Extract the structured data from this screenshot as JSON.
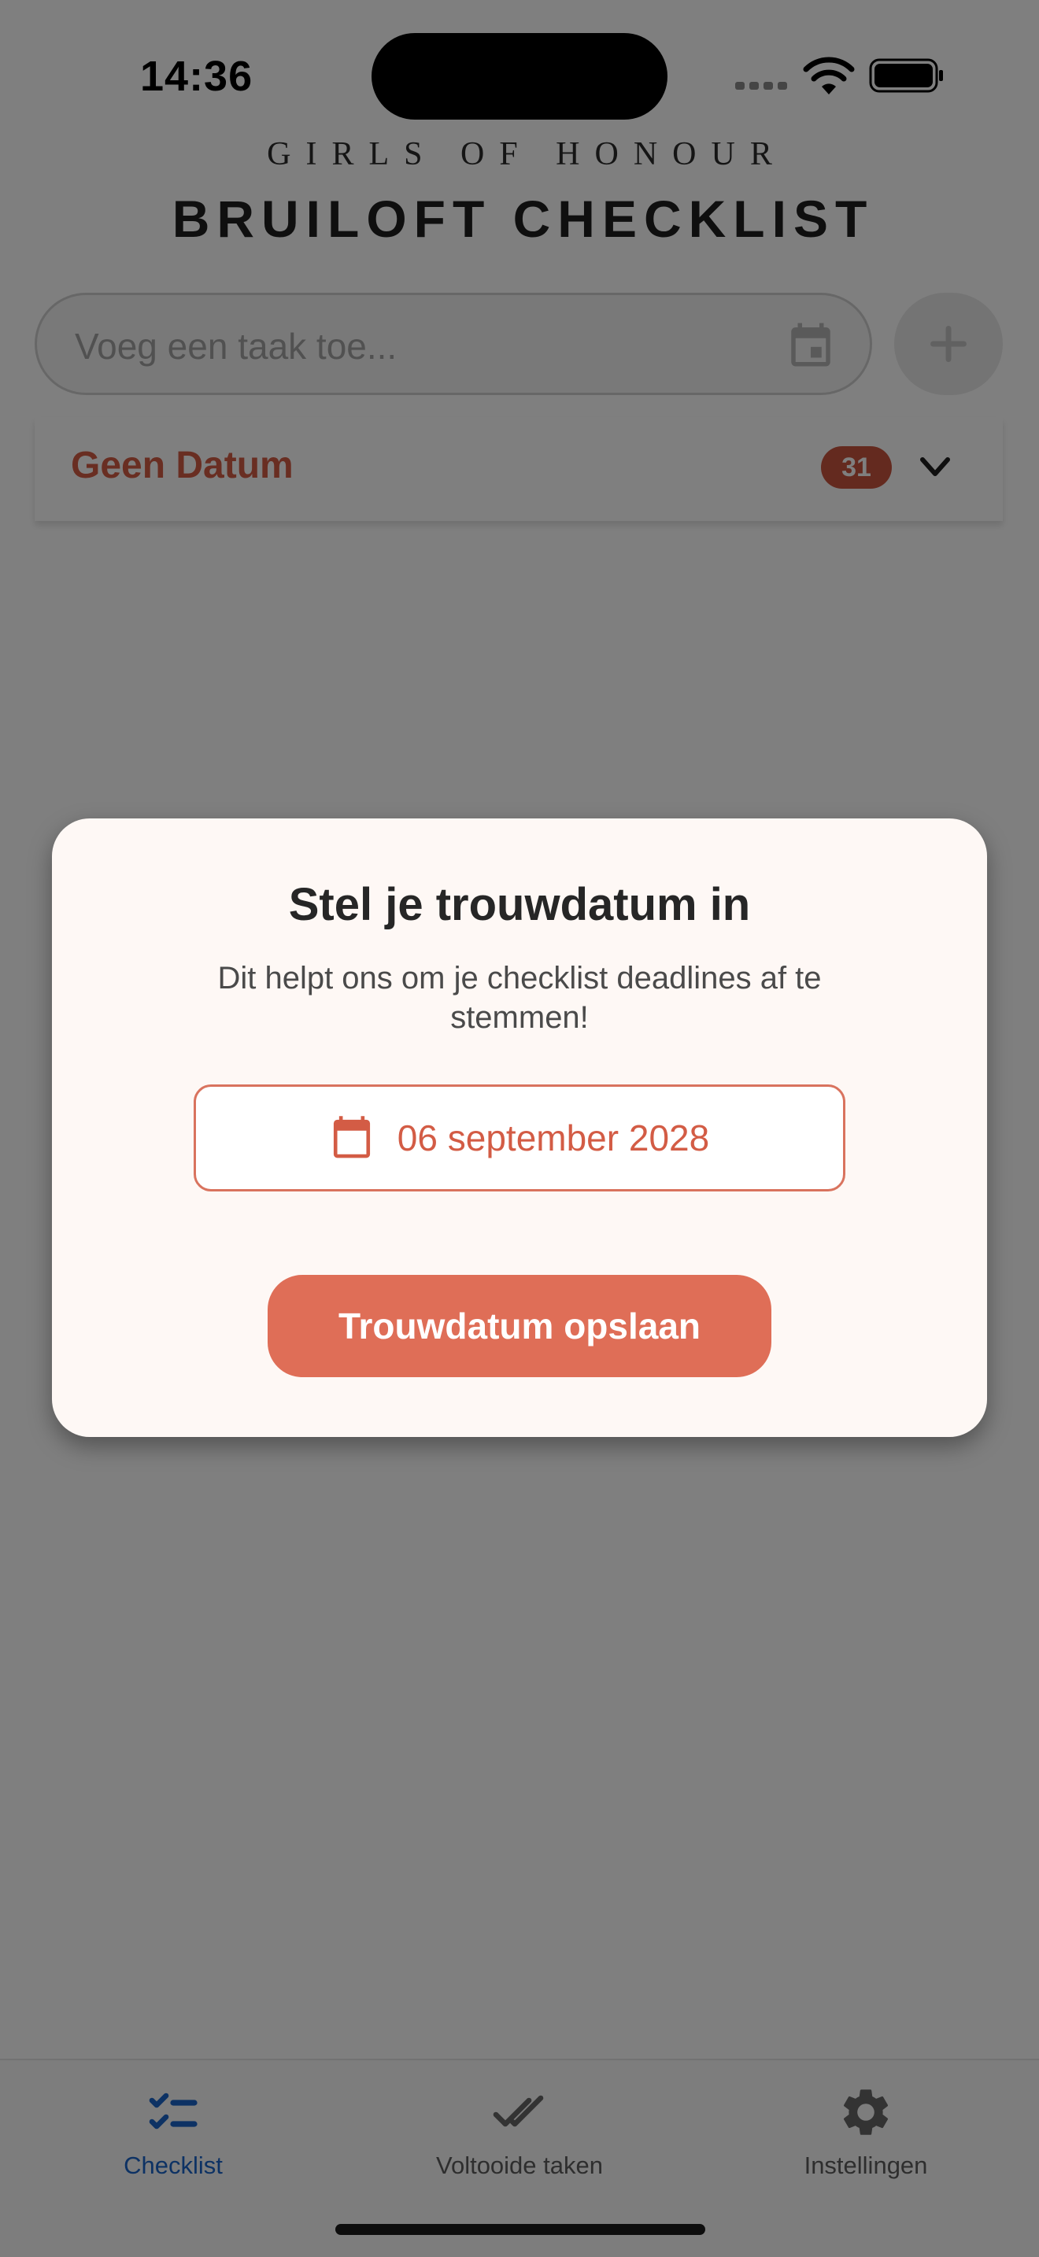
{
  "status_bar": {
    "time": "14:36"
  },
  "header": {
    "brand": "GIRLS OF HONOUR",
    "title": "BRUILOFT CHECKLIST"
  },
  "task_input": {
    "placeholder": "Voeg een taak toe...",
    "date_icon": "calendar-event-icon",
    "add_icon": "plus-icon"
  },
  "section": {
    "title": "Geen Datum",
    "count": "31",
    "toggle_icon": "chevron-down-icon"
  },
  "dialog": {
    "title": "Stel je trouwdatum in",
    "message": "Dit helpt ons om je checklist deadlines af te stemmen!",
    "date_value": "06 september 2028",
    "date_icon": "calendar-icon",
    "save_label": "Trouwdatum opslaan"
  },
  "bottom_nav": {
    "items": [
      {
        "label": "Checklist",
        "icon": "checklist-icon",
        "active": true
      },
      {
        "label": "Voltooide taken",
        "icon": "double-check-icon",
        "active": false
      },
      {
        "label": "Instellingen",
        "icon": "gear-icon",
        "active": false
      }
    ]
  },
  "colors": {
    "accent": "#df6e57",
    "section_title": "#d35c45",
    "badge": "#c8553f",
    "active_nav": "#1a64c8",
    "dialog_bg": "#fef8f5"
  }
}
